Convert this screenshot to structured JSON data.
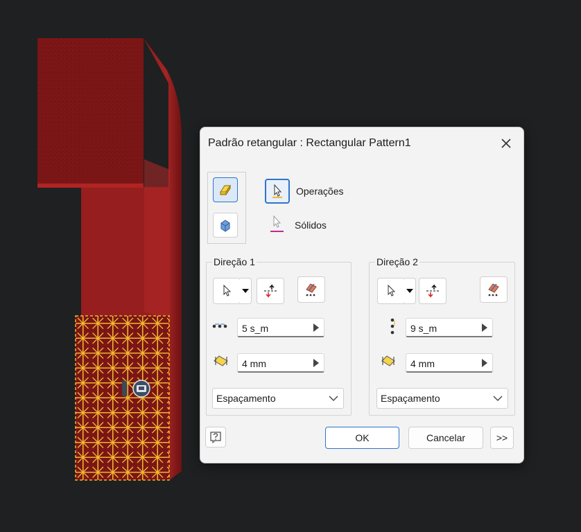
{
  "dialog": {
    "title": "Padrão retangular : Rectangular Pattern1",
    "icons": {
      "close": "close-icon",
      "pattern_features": "pattern-features-icon",
      "pattern_solids": "pattern-solids-icon"
    },
    "selection": {
      "features_label": "Operações",
      "solids_label": "Sólidos"
    },
    "direction1": {
      "label": "Direção 1",
      "count": "5 s_m",
      "spacing": "4 mm",
      "method": "Espaçamento"
    },
    "direction2": {
      "label": "Direção 2",
      "count": "9 s_m",
      "spacing": "4 mm",
      "method": "Espaçamento"
    },
    "buttons": {
      "ok": "OK",
      "cancel": "Cancelar",
      "more": ">>"
    }
  },
  "colors": {
    "background": "#1f2021",
    "part": "#8b1a1a",
    "pattern_highlight": "#f2b630",
    "dialog_bg": "#f3f3f3",
    "accent": "#2f73c8"
  }
}
